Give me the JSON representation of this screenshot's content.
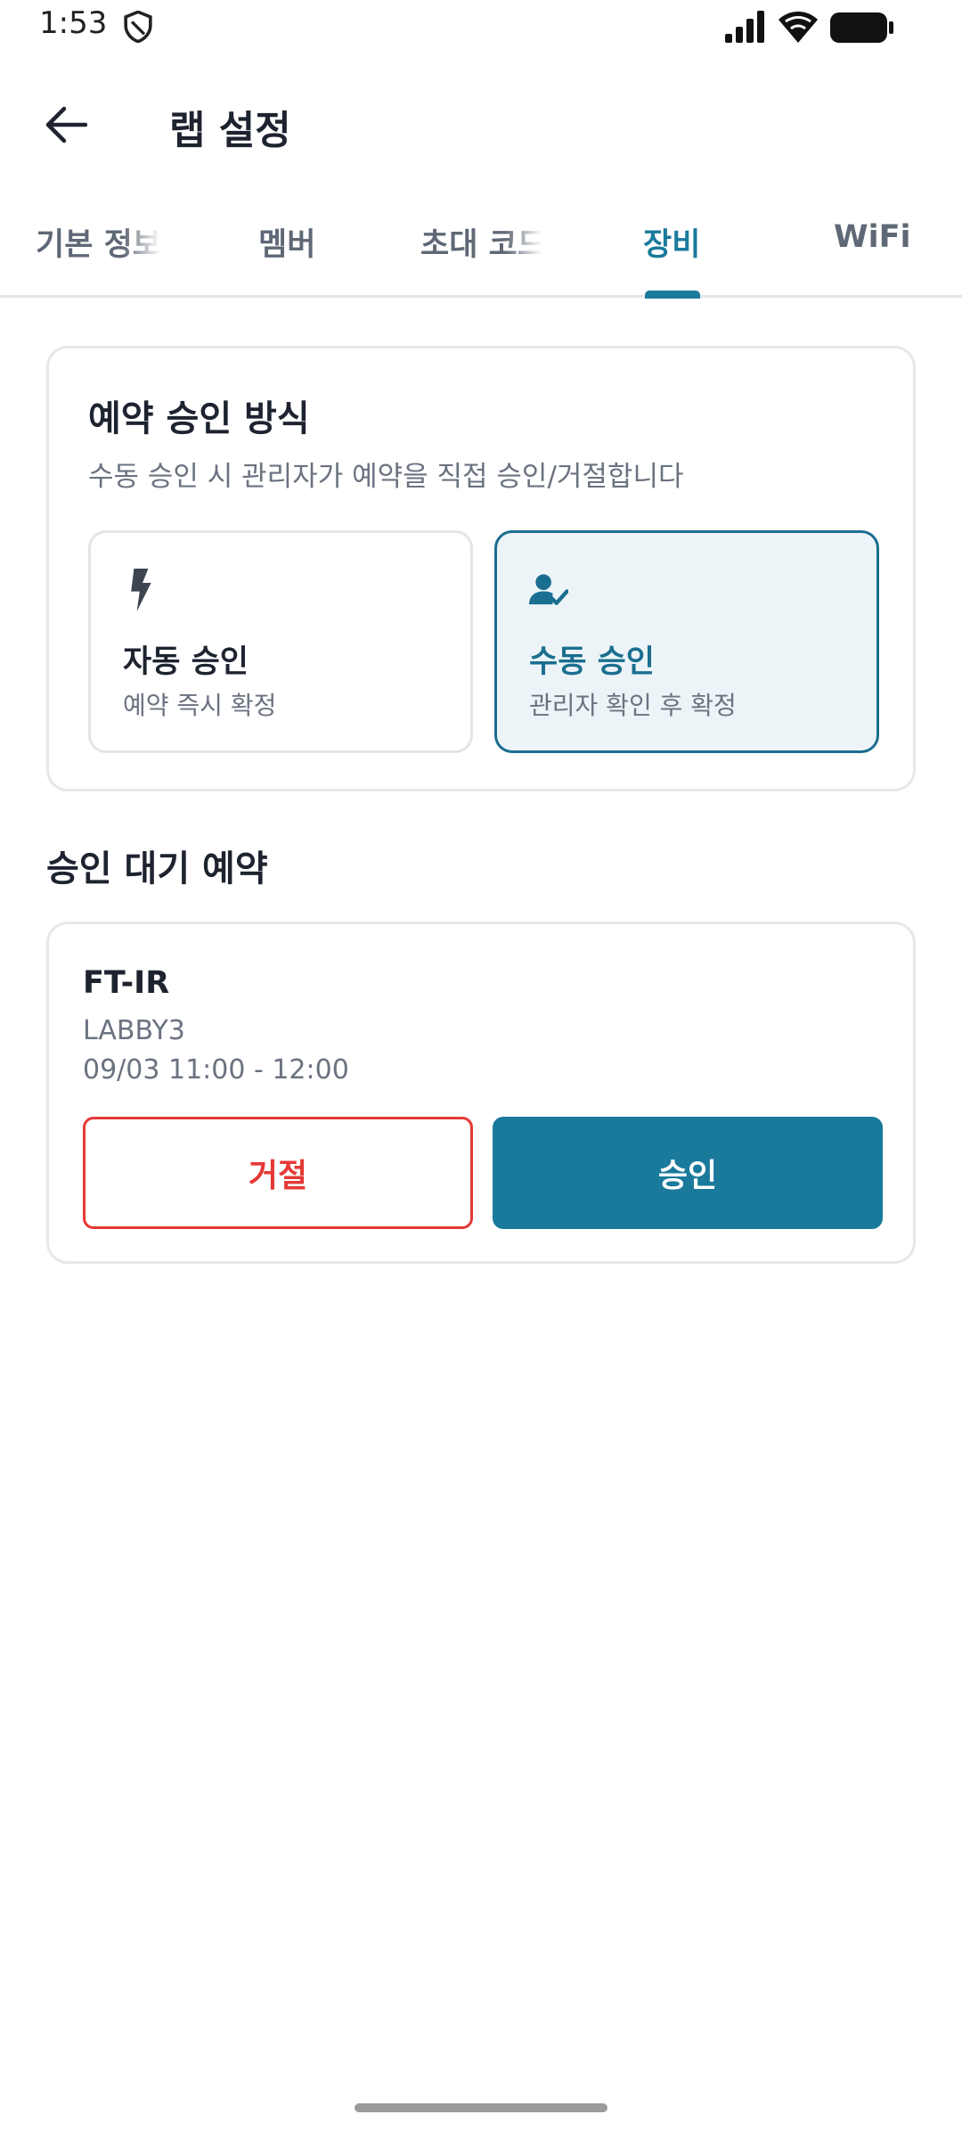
{
  "status_bar": {
    "time": "1:53",
    "icons": [
      "shield-icon",
      "signal-icon",
      "wifi-icon",
      "battery-icon"
    ]
  },
  "app_bar": {
    "title": "랩 설정",
    "back_icon": "arrow-left-icon"
  },
  "tabs": [
    {
      "label": "기본 정보",
      "active": false
    },
    {
      "label": "멤버",
      "active": false
    },
    {
      "label": "초대 코드",
      "active": false
    },
    {
      "label": "장비",
      "active": true
    },
    {
      "label": "WiFi",
      "active": false
    }
  ],
  "approval": {
    "title": "예약 승인 방식",
    "subtitle": "수동 승인 시 관리자가 예약을 직접 승인/거절합니다",
    "options": [
      {
        "label": "자동 승인",
        "desc": "예약 즉시 확정",
        "icon": "lightning-icon",
        "selected": false
      },
      {
        "label": "수동 승인",
        "desc": "관리자 확인 후 확정",
        "icon": "person-check-icon",
        "selected": true
      }
    ]
  },
  "pending": {
    "title": "승인 대기 예약",
    "items": [
      {
        "equipment": "FT-IR",
        "lab": "LABBY3",
        "time": "09/03 11:00 - 12:00",
        "reject_label": "거절",
        "approve_label": "승인"
      }
    ]
  },
  "colors": {
    "accent": "#1a7a9c",
    "reject": "#e53935",
    "selected_bg": "#edf4f7",
    "border": "#e5e7eb"
  }
}
